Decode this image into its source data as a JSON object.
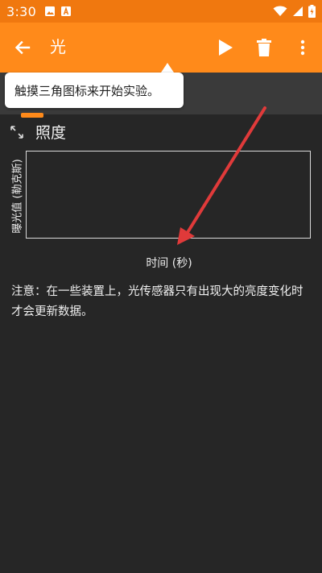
{
  "status_bar": {
    "time": "3:30",
    "icons_left": [
      "image-icon",
      "font-download-icon"
    ],
    "icons_right": [
      "wifi-icon",
      "signal-icon",
      "battery-charging-icon"
    ]
  },
  "app_bar": {
    "title": "光",
    "back_icon": "arrow-back-icon",
    "actions": [
      "play-icon",
      "delete-icon",
      "more-vert-icon"
    ],
    "color": "#ff8a1a"
  },
  "tooltip": {
    "text": "触摸三角图标来开始实验。"
  },
  "section": {
    "title": "照度",
    "expand_icon": "expand-icon"
  },
  "chart_data": {
    "type": "line",
    "ylabel": "曝光值 (勒克斯)",
    "xlabel": "时间 (秒)",
    "series": []
  },
  "note": {
    "text": "注意：在一些装置上，光传感器只有出现大的亮度变化时才会更新数据。"
  },
  "colors": {
    "accent": "#ff8a1a",
    "status_bar": "#f0780f",
    "background": "#262626",
    "annotation_arrow": "#e03a3a"
  }
}
